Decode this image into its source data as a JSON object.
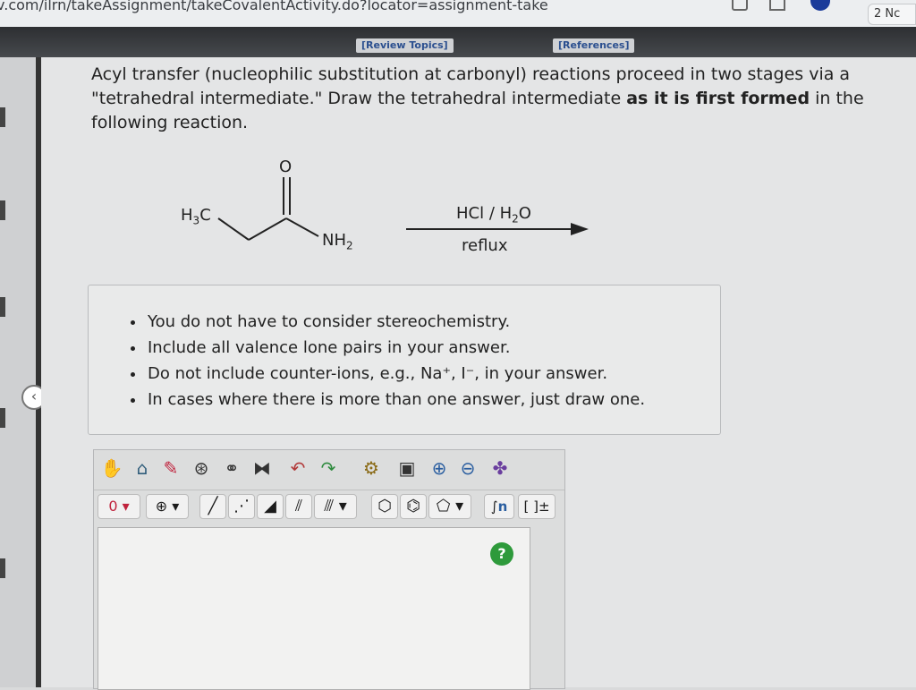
{
  "browser": {
    "url": "v.com/ilrn/takeAssignment/takeCovalentActivity.do?locator=assignment-take",
    "tab_count": "2 Nc"
  },
  "header": {
    "review_topics": "[Review Topics]",
    "references": "[References]"
  },
  "question": {
    "part1": "Acyl transfer (nucleophilic substitution at carbonyl) reactions proceed in two stages via a \"tetrahedral intermediate.\" Draw the tetrahedral intermediate ",
    "bold": "as it is first formed",
    "part2": " in the following reaction."
  },
  "reaction": {
    "oxygen": "O",
    "methyl_main": "H",
    "methyl_sub": "3",
    "methyl_tail": "C",
    "amine_main": "NH",
    "amine_sub": "2",
    "reagent_a": "HCl / H",
    "reagent_sub": "2",
    "reagent_b": "O",
    "condition": "reflux"
  },
  "notes": [
    "You do not have to consider stereochemistry.",
    "Include all valence lone pairs in your answer.",
    "Do not include counter-ions, e.g., Na⁺, I⁻, in your answer.",
    "In cases where there is more than one answer, just draw one."
  ],
  "editor": {
    "charge_value": "0",
    "chain_label": "n",
    "bracket_label": "[ ]±",
    "help_label": "?"
  }
}
